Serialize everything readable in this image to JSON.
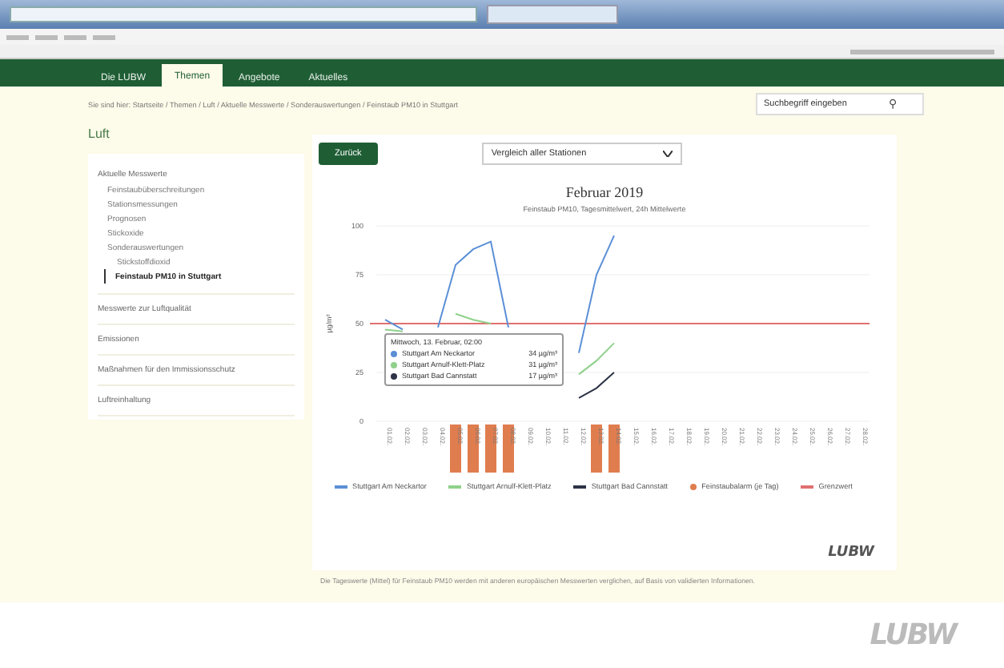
{
  "nav": {
    "tabs": [
      {
        "label": "Die LUBW",
        "selected": false
      },
      {
        "label": "Themen",
        "selected": true
      },
      {
        "label": "Angebote",
        "selected": false
      },
      {
        "label": "Aktuelles",
        "selected": false
      }
    ]
  },
  "breadcrumb": "Sie sind hier: Startseite / Themen / Luft / Aktuelle Messwerte / Sonderauswertungen / Feinstaub PM10 in Stuttgart",
  "search": {
    "placeholder": "Suchbegriff eingeben",
    "button": "⚲"
  },
  "sidebar": {
    "title": "Luft",
    "sections": [
      {
        "label": "Aktuelle Messwerte",
        "children": [
          {
            "label": "Feinstaubüberschreitungen",
            "selected": false
          },
          {
            "label": "Stationsmessungen",
            "selected": false
          },
          {
            "label": "Prognosen",
            "selected": false
          },
          {
            "label": "Stickoxide",
            "selected": false
          },
          {
            "label": "Sonderauswertungen",
            "selected": false,
            "children": [
              {
                "label": "Stickstoffdioxid",
                "selected": false
              },
              {
                "label": "Feinstaub PM10 in Stuttgart",
                "selected": true
              }
            ]
          }
        ]
      },
      {
        "label": "Messwerte zur Luftqualität"
      },
      {
        "label": "Emissionen"
      },
      {
        "label": "Maßnahmen für den Immissionsschutz"
      },
      {
        "label": "Luftreinhaltung"
      }
    ]
  },
  "toolbar": {
    "back_button": "Zurück",
    "select": "Vergleich aller Stationen"
  },
  "chart": {
    "title": "Februar 2019",
    "subtitle": "Feinstaub PM10, Tagesmittelwert, 24h Mittelwerte",
    "chart_data": {
      "type": "line",
      "ylabel": "µg/m³",
      "categories": [
        "01.02.",
        "02.02.",
        "03.02.",
        "04.02.",
        "05.02.",
        "06.02.",
        "07.02.",
        "08.02.",
        "09.02.",
        "10.02.",
        "11.02.",
        "12.02.",
        "13.02.",
        "14.02.",
        "15.02.",
        "16.02.",
        "17.02.",
        "18.02.",
        "19.02.",
        "20.02.",
        "21.02.",
        "22.02.",
        "23.02.",
        "24.02.",
        "25.02.",
        "26.02.",
        "27.02.",
        "28.02."
      ],
      "series": [
        {
          "name": "Stuttgart Am Neckartor",
          "color": "#5b8fd6",
          "values": [
            52,
            47,
            null,
            48,
            80,
            88,
            92,
            48,
            null,
            null,
            null,
            35,
            75,
            95,
            null,
            null,
            null,
            null,
            null,
            null,
            null,
            null,
            null,
            null,
            null,
            null,
            null,
            null
          ]
        },
        {
          "name": "Stuttgart Arnulf-Klett-Platz",
          "color": "#8fd18a",
          "values": [
            47,
            46,
            null,
            null,
            55,
            52,
            50,
            null,
            null,
            null,
            null,
            24,
            31,
            40,
            null,
            null,
            null,
            null,
            null,
            null,
            null,
            null,
            null,
            null,
            null,
            null,
            null,
            null
          ]
        },
        {
          "name": "Stuttgart Bad Cannstatt",
          "color": "#2e3447",
          "values": [
            null,
            null,
            null,
            null,
            null,
            null,
            null,
            null,
            null,
            null,
            null,
            12,
            17,
            25,
            null,
            null,
            null,
            null,
            null,
            null,
            null,
            null,
            null,
            null,
            null,
            null,
            null,
            null
          ]
        }
      ],
      "ylim": [
        0,
        100
      ],
      "yticks": [
        0,
        25,
        50,
        75,
        100
      ],
      "ref_lines": [
        {
          "axis": "y",
          "value": 50,
          "color": "#e07070",
          "label": "Grenzwert"
        }
      ],
      "legend": "bottom"
    },
    "tooltip": {
      "title": "Mittwoch, 13. Februar, 02:00",
      "rows": [
        {
          "label": "Stuttgart Am Neckartor",
          "value": "34 µg/m³",
          "color": "#5b8fd6"
        },
        {
          "label": "Stuttgart Arnulf-Klett-Platz",
          "value": "31 µg/m³",
          "color": "#8fd18a"
        },
        {
          "label": "Stuttgart Bad Cannstatt",
          "value": "17 µg/m³",
          "color": "#2e3447"
        }
      ]
    },
    "alarm": {
      "label": "Feinstaubalarm (je Tag)",
      "color": "#e07d4f",
      "days": [
        {
          "on": false
        },
        {
          "on": false
        },
        {
          "on": false
        },
        {
          "on": false
        },
        {
          "on": true
        },
        {
          "on": true
        },
        {
          "on": true
        },
        {
          "on": true
        },
        {
          "on": false
        },
        {
          "on": false
        },
        {
          "on": false
        },
        {
          "on": false
        },
        {
          "on": true
        },
        {
          "on": true
        },
        {
          "on": false
        },
        {
          "on": false
        },
        {
          "on": false
        },
        {
          "on": false
        },
        {
          "on": false
        },
        {
          "on": false
        },
        {
          "on": false
        },
        {
          "on": false
        },
        {
          "on": false
        },
        {
          "on": false
        },
        {
          "on": false
        },
        {
          "on": false
        },
        {
          "on": false
        },
        {
          "on": false
        }
      ]
    },
    "logo": "LUBW"
  },
  "page_logo": "LUBW",
  "footnote": "Die Tageswerte (Mittel) für Feinstaub PM10 werden mit anderen europäischen Messwerten verglichen, auf Basis von validierten Informationen."
}
